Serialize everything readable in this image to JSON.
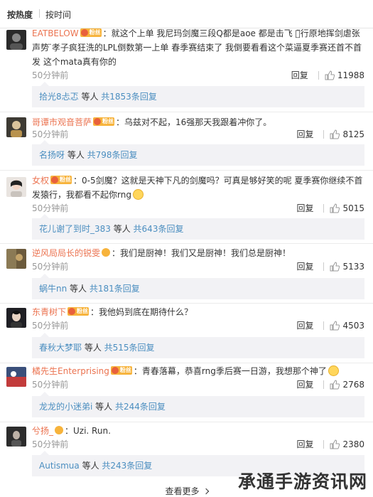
{
  "sort": {
    "by_hot": "按热度",
    "by_time": "按时间"
  },
  "badge_label": "粉丝",
  "reply_label": "回复",
  "more_label": "查看更多",
  "watermark": "承通手游资讯网",
  "comments": [
    {
      "username": "EATBELOW",
      "text": "：就这个上单 我尼玛剑魔三段Q都是aoe 都是击飞  你̈行原地挥剑虐张声势 ̈孝子疯狂洗的LPL倒数第一上单 春季赛结束了 我倒要看看这个菜逼夏季赛还首不首发    这个mata真有你的",
      "time": "50分钟前",
      "likes": "11988",
      "reply_user": "拾光8忐忑",
      "reply_mid": " 等人 ",
      "reply_count": "共1853条回复"
    },
    {
      "username": "哥谭市观音菩萨",
      "text": "：乌兹对不起，16强那天我跟着冲你了。",
      "time": "50分钟前",
      "likes": "8125",
      "reply_user": "名扬呀",
      "reply_mid": " 等人 ",
      "reply_count": "共798条回复"
    },
    {
      "username": "女权",
      "text": "：0-5剑魔？这就是天神下凡的剑魔吗？可真是够好笑的呢 夏季赛你继续不首发猿行，我都看不起你rng",
      "time": "50分钟前",
      "likes": "5015",
      "reply_user": "花儿谢了到时_383",
      "reply_mid": " 等人 ",
      "reply_count": "共643条回复"
    },
    {
      "username": "逆风局局长的锐雯",
      "text": "：我们是厨神！我们又是厨神！我们总是厨神！",
      "time": "50分钟前",
      "likes": "5133",
      "reply_user": "蜗牛nn",
      "reply_mid": " 等人 ",
      "reply_count": "共181条回复"
    },
    {
      "username": "东青树下",
      "text": "：我他妈到底在期待什么？",
      "time": "50分钟前",
      "likes": "4503",
      "reply_user": "春秋大梦耶",
      "reply_mid": " 等人 ",
      "reply_count": "共515条回复"
    },
    {
      "username": "橘先生Enterprising",
      "text": "：青春落幕，恭喜rng季后赛一日游，我想那个神了",
      "time": "50分钟前",
      "likes": "2768",
      "reply_user": "龙龙的小迷弟i",
      "reply_mid": " 等人 ",
      "reply_count": "共244条回复"
    },
    {
      "username": "兮扬_",
      "text": "：Uzi. Run.",
      "time": "50分钟前",
      "likes": "2380",
      "reply_user": "Autismua",
      "reply_mid": " 等人 ",
      "reply_count": "共243条回复"
    }
  ]
}
